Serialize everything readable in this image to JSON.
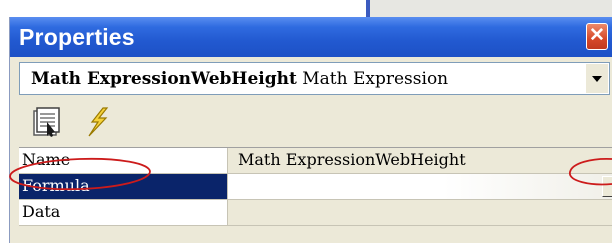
{
  "window": {
    "title": "Properties",
    "close_glyph": "✕"
  },
  "object_selector": {
    "name": "Math ExpressionWebHeight",
    "type": "Math Expression"
  },
  "toolbar": {
    "buttons": [
      {
        "name": "properties-icon"
      },
      {
        "name": "events-icon"
      }
    ]
  },
  "grid": {
    "rows": [
      {
        "name": "Name",
        "value": "Math ExpressionWebHeight",
        "selected": false
      },
      {
        "name": "Formula",
        "value": "",
        "selected": true
      },
      {
        "name": "Data",
        "value": "",
        "selected": false
      }
    ]
  },
  "colors": {
    "title_bar": "#2259d0",
    "selection": "#0a246a",
    "panel": "#ece9d8",
    "annotation": "#cc1b1b"
  }
}
